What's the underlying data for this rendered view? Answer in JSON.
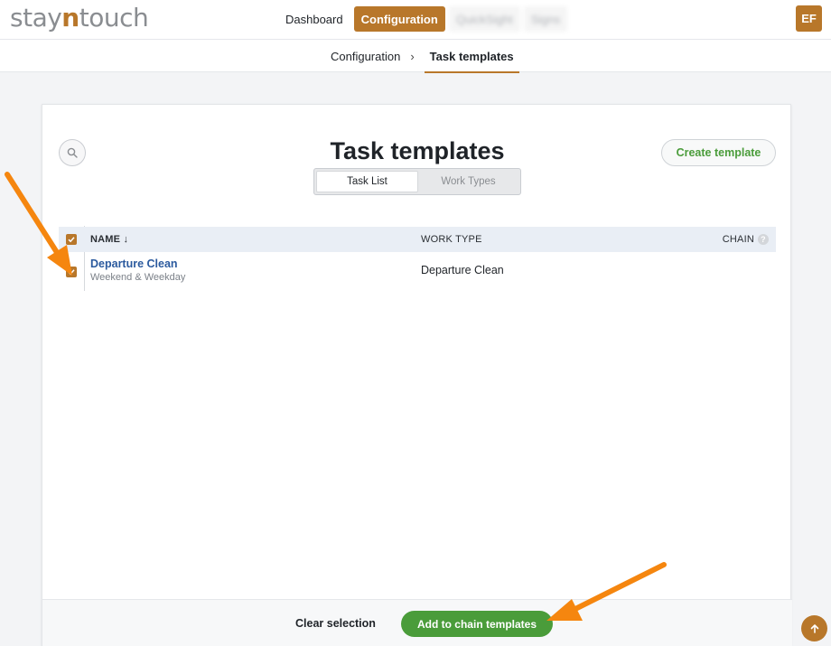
{
  "brand": {
    "logo_before": "stay",
    "logo_n": "n",
    "logo_after": "touch",
    "accent": "#b8772a"
  },
  "nav": {
    "items": [
      {
        "label": "Dashboard",
        "state": "normal"
      },
      {
        "label": "Configuration",
        "state": "active"
      },
      {
        "label": "QuickSight",
        "state": "blurred"
      },
      {
        "label": "Signs",
        "state": "blurred"
      }
    ],
    "avatar_initials": "EF"
  },
  "breadcrumb": {
    "parent": "Configuration",
    "separator": "›",
    "current": "Task templates"
  },
  "page": {
    "title": "Task templates",
    "create_button": "Create template",
    "tabs": [
      {
        "label": "Task List",
        "selected": true
      },
      {
        "label": "Work Types",
        "selected": false
      }
    ]
  },
  "table": {
    "columns": {
      "name": "NAME ↓",
      "work_type": "WORK TYPE",
      "chain": "CHAIN",
      "chain_help": "?"
    },
    "rows": [
      {
        "name": "Departure Clean",
        "schedule": "Weekend & Weekday",
        "work_type": "Departure Clean",
        "checked": true
      }
    ]
  },
  "footer": {
    "clear_label": "Clear selection",
    "add_label": "Add to chain templates",
    "add_color": "#4a9c3a"
  },
  "annotations": {
    "arrow_color": "#f5860f"
  }
}
